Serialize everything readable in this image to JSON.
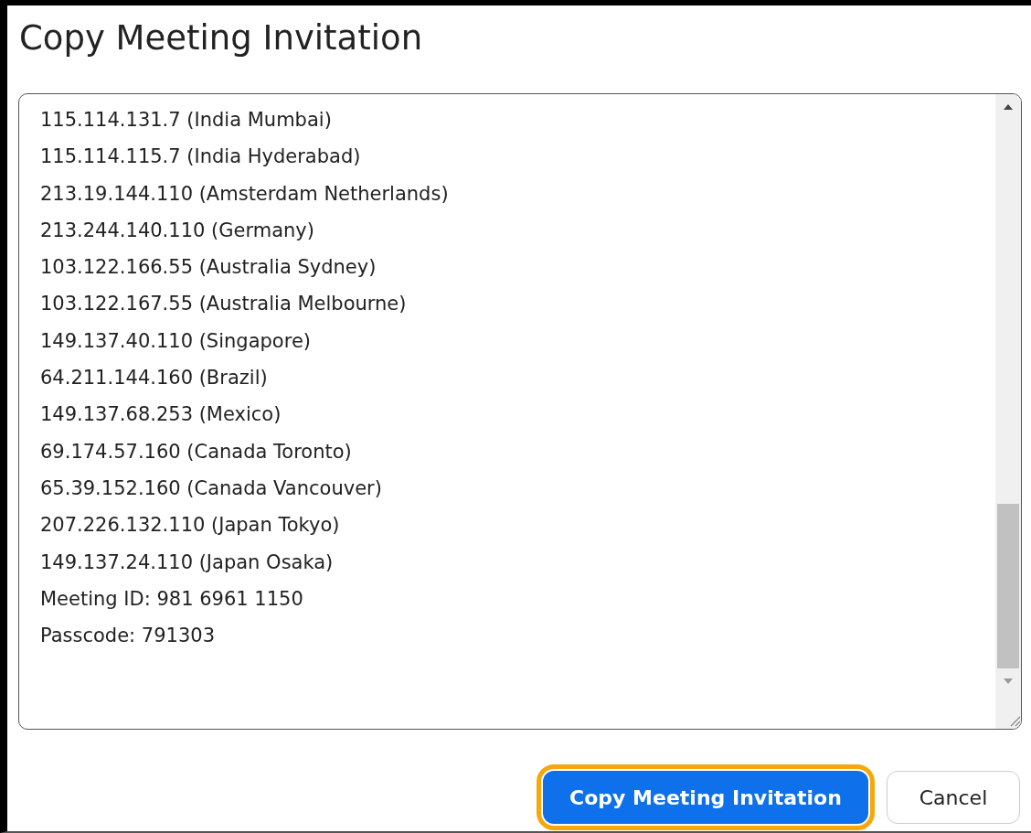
{
  "dialog": {
    "title": "Copy Meeting Invitation"
  },
  "invitation_lines": [
    "115.114.131.7 (India Mumbai)",
    "115.114.115.7 (India Hyderabad)",
    "213.19.144.110 (Amsterdam Netherlands)",
    "213.244.140.110 (Germany)",
    "103.122.166.55 (Australia Sydney)",
    "103.122.167.55 (Australia Melbourne)",
    "149.137.40.110 (Singapore)",
    "64.211.144.160 (Brazil)",
    "149.137.68.253 (Mexico)",
    "69.174.57.160 (Canada Toronto)",
    "65.39.152.160 (Canada Vancouver)",
    "207.226.132.110 (Japan Tokyo)",
    "149.137.24.110 (Japan Osaka)",
    "Meeting ID: 981 6961 1150",
    "Passcode: 791303"
  ],
  "buttons": [
    {
      "label": "Copy Meeting Invitation",
      "kind": "primary",
      "highlighted": true
    },
    {
      "label": "Cancel",
      "kind": "secondary",
      "highlighted": false
    }
  ]
}
